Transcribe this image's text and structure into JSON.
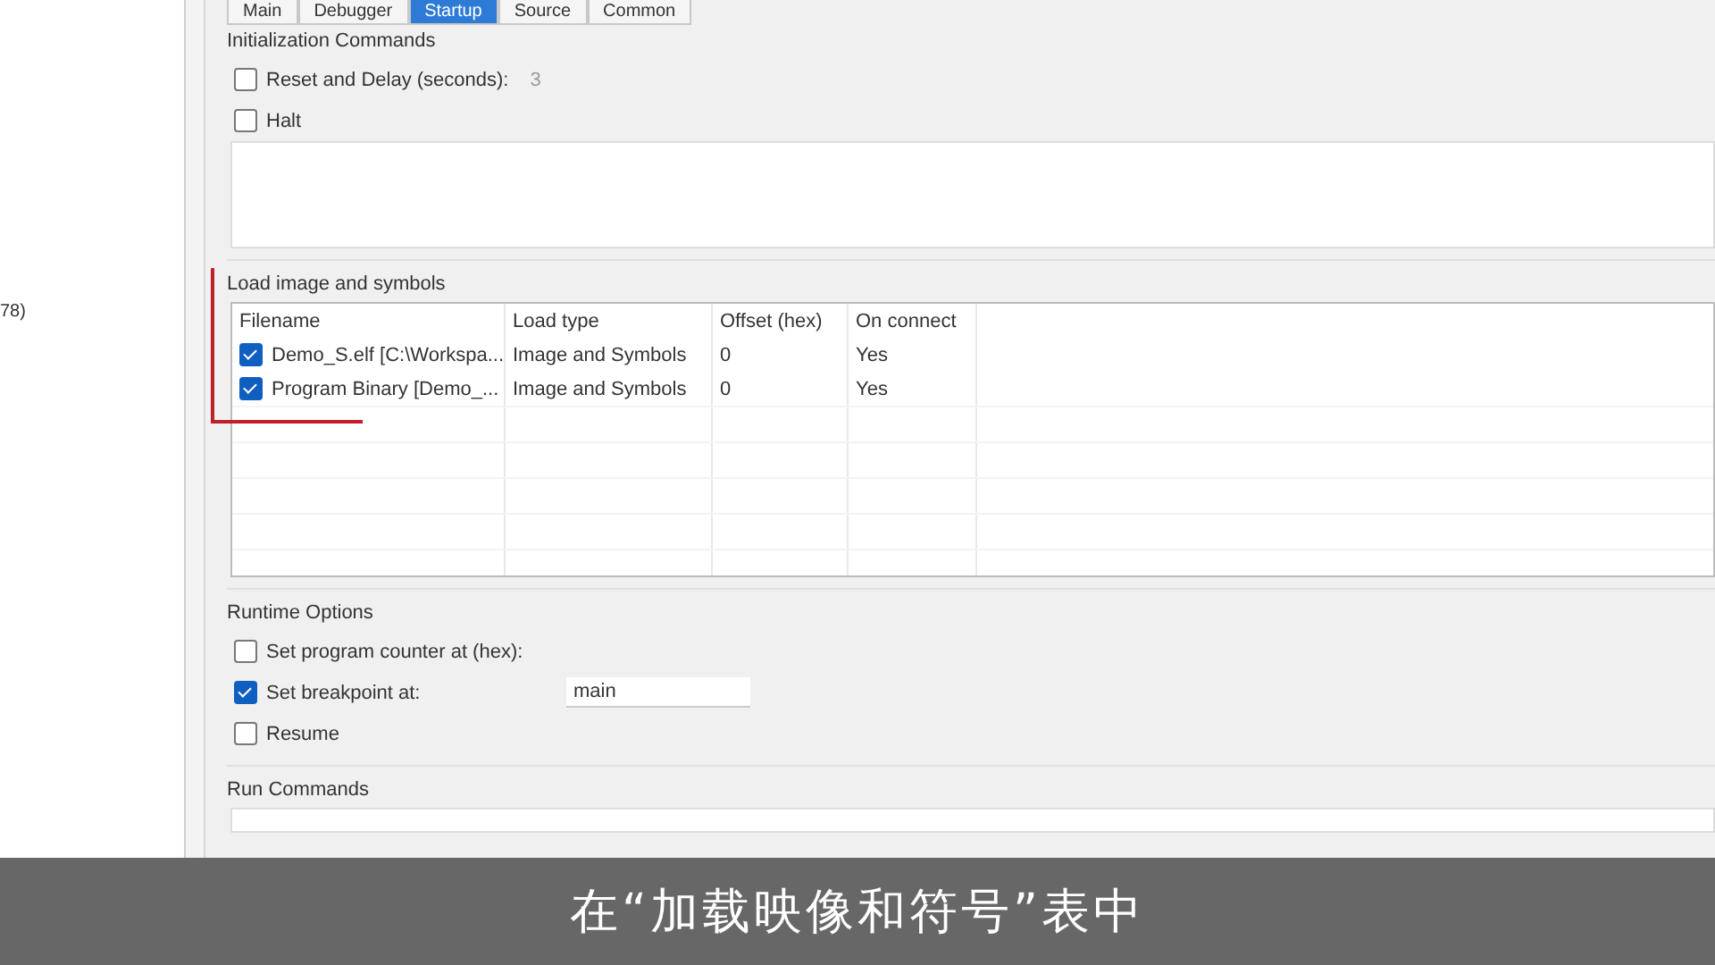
{
  "left_panel": {
    "text": "78)"
  },
  "tabs": [
    {
      "label": "Main",
      "selected": false
    },
    {
      "label": "Debugger",
      "selected": false
    },
    {
      "label": "Startup",
      "selected": true
    },
    {
      "label": "Source",
      "selected": false
    },
    {
      "label": "Common",
      "selected": false
    }
  ],
  "init_commands": {
    "title": "Initialization Commands",
    "options": [
      {
        "label": "Reset and Delay (seconds):",
        "checked": false,
        "value": "3",
        "disabled": true
      },
      {
        "label": "Halt",
        "checked": false
      }
    ]
  },
  "load_table": {
    "title": "Load image and symbols",
    "columns": [
      "Filename",
      "Load type",
      "Offset (hex)",
      "On connect"
    ],
    "rows": [
      {
        "checked": true,
        "cells": [
          "Demo_S.elf [C:\\Workspa...",
          "Image and Symbols",
          "0",
          "Yes"
        ]
      },
      {
        "checked": true,
        "cells": [
          "Program Binary [Demo_...",
          "Image and Symbols",
          "0",
          "Yes"
        ]
      }
    ]
  },
  "runtime_options": {
    "title": "Runtime Options",
    "options": [
      {
        "label": "Set program counter at (hex):",
        "checked": false
      },
      {
        "label": "Set breakpoint at:",
        "checked": true,
        "value": "main",
        "disabled": false
      },
      {
        "label": "Resume",
        "checked": false
      }
    ]
  },
  "run_commands": {
    "title": "Run Commands"
  },
  "subtitle": "在“加载映像和符号”表中"
}
